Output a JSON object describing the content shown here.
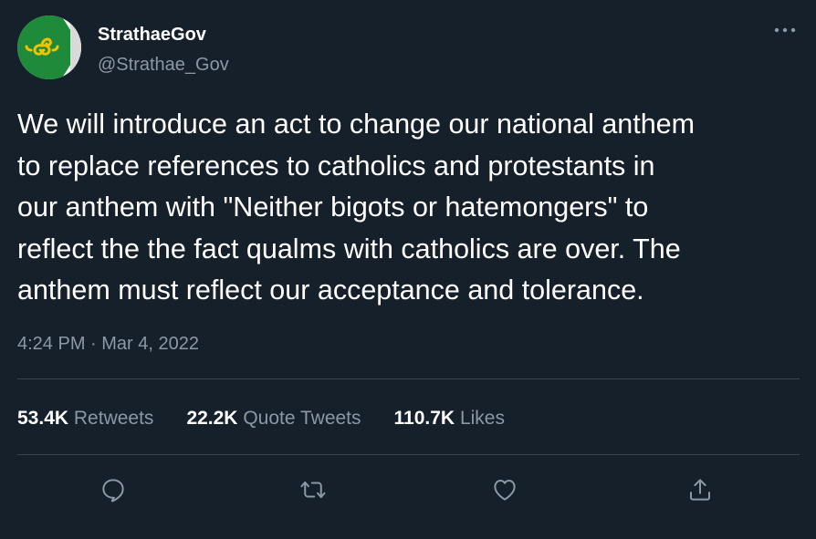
{
  "author": {
    "display_name": "StrathaeGov",
    "handle": "@Strathae_Gov",
    "avatar_icon": "triskelion-flag-avatar",
    "avatar_colors": {
      "green": "#1f8a3a",
      "white": "#f2f2f2",
      "gold": "#f2c200"
    }
  },
  "tweet": {
    "text": "We will introduce an act to change our national anthem\nto replace references to catholics and protestants in\nour anthem with \"Neither bigots or hatemongers\" to\nreflect the the fact qualms with catholics are over. The\nanthem must reflect our acceptance and tolerance.",
    "timestamp": "4:24 PM · Mar 4, 2022"
  },
  "stats": {
    "retweets": {
      "count": "53.4K",
      "label": "Retweets"
    },
    "quote_tweets": {
      "count": "22.2K",
      "label": "Quote Tweets"
    },
    "likes": {
      "count": "110.7K",
      "label": "Likes"
    }
  },
  "actions": {
    "reply_icon": "reply-icon",
    "retweet_icon": "retweet-icon",
    "like_icon": "heart-icon",
    "share_icon": "share-icon"
  },
  "theme": {
    "background": "#15202b",
    "text": "#ffffff",
    "secondary_text": "#8b98a5",
    "divider": "#38444d"
  }
}
